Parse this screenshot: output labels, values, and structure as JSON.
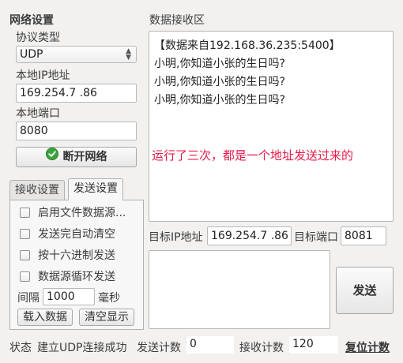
{
  "network": {
    "group_title": "网络设置",
    "protocol_label": "协议类型",
    "protocol_value": "UDP",
    "local_ip_label": "本地IP地址",
    "local_ip_value": "169.254.7 .86",
    "local_port_label": "本地端口",
    "local_port_value": "8080",
    "disconnect_button": "断开网络"
  },
  "tabs": {
    "receive_settings": "接收设置",
    "send_settings": "发送设置",
    "active": "send_settings"
  },
  "send_settings": {
    "enable_file_source": "启用文件数据源...",
    "auto_clear": "发送完自动清空",
    "send_hex": "按十六进制发送",
    "loop_send": "数据源循环发送",
    "interval_label": "间隔",
    "interval_value": "1000",
    "interval_unit": "毫秒",
    "load_data_button": "载入数据",
    "clear_display_button": "清空显示"
  },
  "receive_area": {
    "title": "数据接收区",
    "lines": [
      "【数据来自192.168.36.235:5400】",
      "小明,你知道小张的生日吗?",
      "小明,你知道小张的生日吗?",
      "小明,你知道小张的生日吗?"
    ],
    "annotation": "运行了三次，都是一个地址发送过来的",
    "annotation_color": "#e8194a"
  },
  "target": {
    "ip_label": "目标IP地址",
    "ip_value": "169.254.7 .86",
    "port_label": "目标端口",
    "port_value": "8081",
    "send_button": "发送",
    "send_text": ""
  },
  "status": {
    "state_label": "状态",
    "state_text": "建立UDP连接成功",
    "send_count_label": "发送计数",
    "send_count": "0",
    "recv_count_label": "接收计数",
    "recv_count": "120",
    "reset_link": "复位计数"
  },
  "icons": {
    "disconnect_icon": "check-circle-icon",
    "select_icon": "updown-chevron-icon"
  }
}
